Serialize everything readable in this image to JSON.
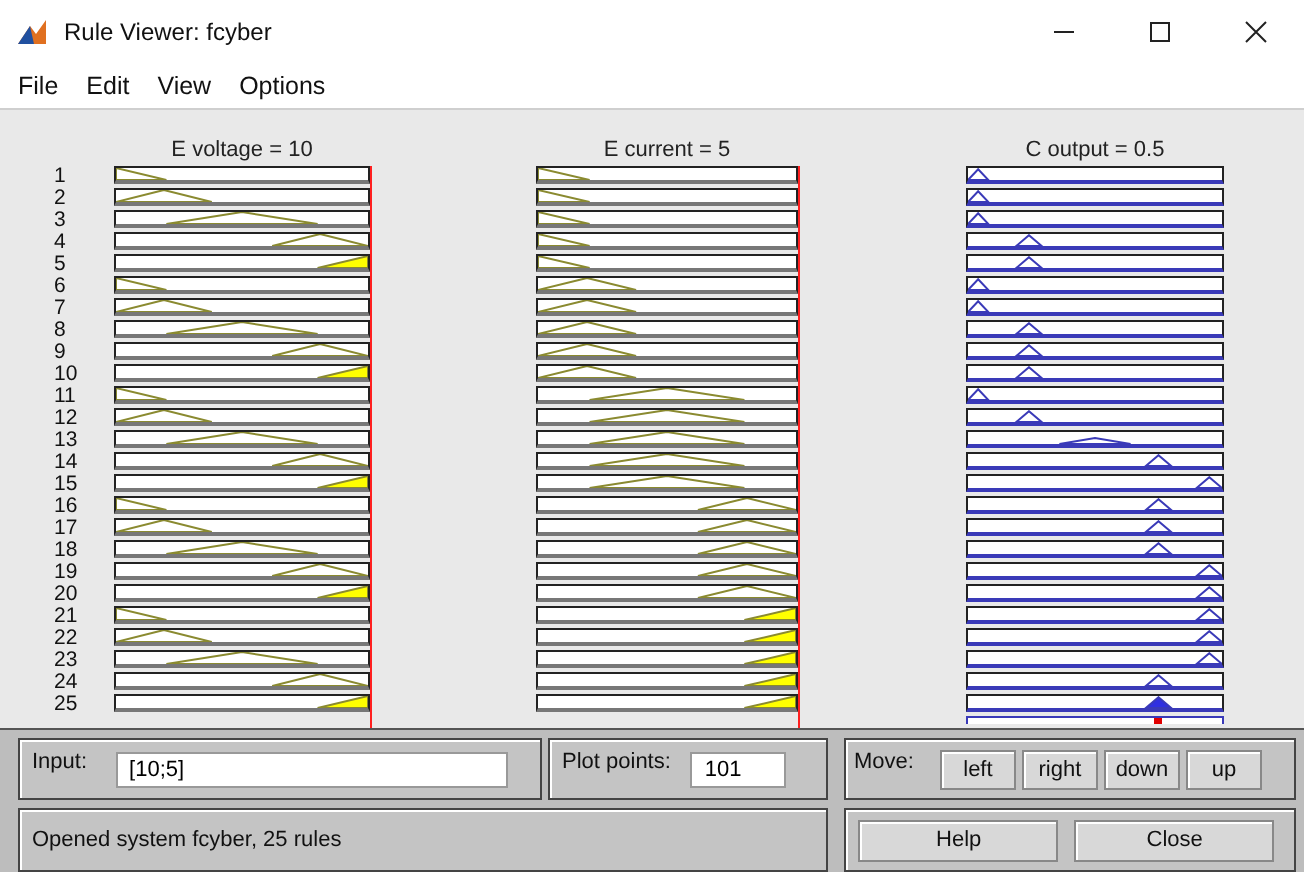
{
  "window": {
    "title": "Rule Viewer: fcyber"
  },
  "menu": [
    "File",
    "Edit",
    "View",
    "Options"
  ],
  "columns": [
    {
      "title": "E voltage = 10",
      "kind": "input"
    },
    {
      "title": "E current = 5",
      "kind": "input"
    },
    {
      "title": "C output = 0.5",
      "kind": "output"
    }
  ],
  "rules": [
    {
      "number": "1",
      "cells": [
        {
          "kind": "mf1",
          "fired": false
        },
        {
          "kind": "mf1",
          "fired": false
        },
        {
          "kind": "mf1",
          "fired": false
        }
      ]
    },
    {
      "number": "2",
      "cells": [
        {
          "kind": "mf2",
          "fired": false
        },
        {
          "kind": "mf1",
          "fired": false
        },
        {
          "kind": "mf1",
          "fired": false
        }
      ]
    },
    {
      "number": "3",
      "cells": [
        {
          "kind": "mf3",
          "fired": false
        },
        {
          "kind": "mf1",
          "fired": false
        },
        {
          "kind": "mf1",
          "fired": false
        }
      ]
    },
    {
      "number": "4",
      "cells": [
        {
          "kind": "mf4",
          "fired": false
        },
        {
          "kind": "mf1",
          "fired": false
        },
        {
          "kind": "mf2",
          "fired": false
        }
      ]
    },
    {
      "number": "5",
      "cells": [
        {
          "kind": "mf5",
          "fired": true
        },
        {
          "kind": "mf1",
          "fired": false
        },
        {
          "kind": "mf2",
          "fired": false
        }
      ]
    },
    {
      "number": "6",
      "cells": [
        {
          "kind": "mf1",
          "fired": false
        },
        {
          "kind": "mf2",
          "fired": false
        },
        {
          "kind": "mf1",
          "fired": false
        }
      ]
    },
    {
      "number": "7",
      "cells": [
        {
          "kind": "mf2",
          "fired": false
        },
        {
          "kind": "mf2",
          "fired": false
        },
        {
          "kind": "mf1",
          "fired": false
        }
      ]
    },
    {
      "number": "8",
      "cells": [
        {
          "kind": "mf3",
          "fired": false
        },
        {
          "kind": "mf2",
          "fired": false
        },
        {
          "kind": "mf2",
          "fired": false
        }
      ]
    },
    {
      "number": "9",
      "cells": [
        {
          "kind": "mf4",
          "fired": false
        },
        {
          "kind": "mf2",
          "fired": false
        },
        {
          "kind": "mf2",
          "fired": false
        }
      ]
    },
    {
      "number": "10",
      "cells": [
        {
          "kind": "mf5",
          "fired": true
        },
        {
          "kind": "mf2",
          "fired": false
        },
        {
          "kind": "mf2",
          "fired": false
        }
      ]
    },
    {
      "number": "11",
      "cells": [
        {
          "kind": "mf1",
          "fired": false
        },
        {
          "kind": "mf3",
          "fired": false
        },
        {
          "kind": "mf1",
          "fired": false
        }
      ]
    },
    {
      "number": "12",
      "cells": [
        {
          "kind": "mf2",
          "fired": false
        },
        {
          "kind": "mf3",
          "fired": false
        },
        {
          "kind": "mf2",
          "fired": false
        }
      ]
    },
    {
      "number": "13",
      "cells": [
        {
          "kind": "mf3",
          "fired": false
        },
        {
          "kind": "mf3",
          "fired": false
        },
        {
          "kind": "mf3",
          "fired": false
        }
      ]
    },
    {
      "number": "14",
      "cells": [
        {
          "kind": "mf4",
          "fired": false
        },
        {
          "kind": "mf3",
          "fired": false
        },
        {
          "kind": "mf4",
          "fired": false
        }
      ]
    },
    {
      "number": "15",
      "cells": [
        {
          "kind": "mf5",
          "fired": true
        },
        {
          "kind": "mf3",
          "fired": false
        },
        {
          "kind": "mf5",
          "fired": false
        }
      ]
    },
    {
      "number": "16",
      "cells": [
        {
          "kind": "mf1",
          "fired": false
        },
        {
          "kind": "mf4",
          "fired": false
        },
        {
          "kind": "mf4",
          "fired": false
        }
      ]
    },
    {
      "number": "17",
      "cells": [
        {
          "kind": "mf2",
          "fired": false
        },
        {
          "kind": "mf4",
          "fired": false
        },
        {
          "kind": "mf4",
          "fired": false
        }
      ]
    },
    {
      "number": "18",
      "cells": [
        {
          "kind": "mf3",
          "fired": false
        },
        {
          "kind": "mf4",
          "fired": false
        },
        {
          "kind": "mf4",
          "fired": false
        }
      ]
    },
    {
      "number": "19",
      "cells": [
        {
          "kind": "mf4",
          "fired": false
        },
        {
          "kind": "mf4",
          "fired": false
        },
        {
          "kind": "mf5",
          "fired": false
        }
      ]
    },
    {
      "number": "20",
      "cells": [
        {
          "kind": "mf5",
          "fired": true
        },
        {
          "kind": "mf4",
          "fired": false
        },
        {
          "kind": "mf5",
          "fired": false
        }
      ]
    },
    {
      "number": "21",
      "cells": [
        {
          "kind": "mf1",
          "fired": false
        },
        {
          "kind": "mf5",
          "fired": true
        },
        {
          "kind": "mf5",
          "fired": false
        }
      ]
    },
    {
      "number": "22",
      "cells": [
        {
          "kind": "mf2",
          "fired": false
        },
        {
          "kind": "mf5",
          "fired": true
        },
        {
          "kind": "mf5",
          "fired": false
        }
      ]
    },
    {
      "number": "23",
      "cells": [
        {
          "kind": "mf3",
          "fired": false
        },
        {
          "kind": "mf5",
          "fired": true
        },
        {
          "kind": "mf5",
          "fired": false
        }
      ]
    },
    {
      "number": "24",
      "cells": [
        {
          "kind": "mf4",
          "fired": false
        },
        {
          "kind": "mf5",
          "fired": true
        },
        {
          "kind": "mf4",
          "fired": false
        }
      ]
    },
    {
      "number": "25",
      "cells": [
        {
          "kind": "mf5",
          "fired": true
        },
        {
          "kind": "mf5",
          "fired": true
        },
        {
          "kind": "mf4",
          "fired": true
        }
      ]
    }
  ],
  "input": {
    "label": "Input:",
    "value": "[10;5]"
  },
  "plot_points": {
    "label": "Plot points:",
    "value": "101"
  },
  "move": {
    "label": "Move:",
    "buttons": [
      "left",
      "right",
      "down",
      "up"
    ]
  },
  "status": "Opened system fcyber, 25 rules",
  "buttons": [
    "Help",
    "Close"
  ]
}
